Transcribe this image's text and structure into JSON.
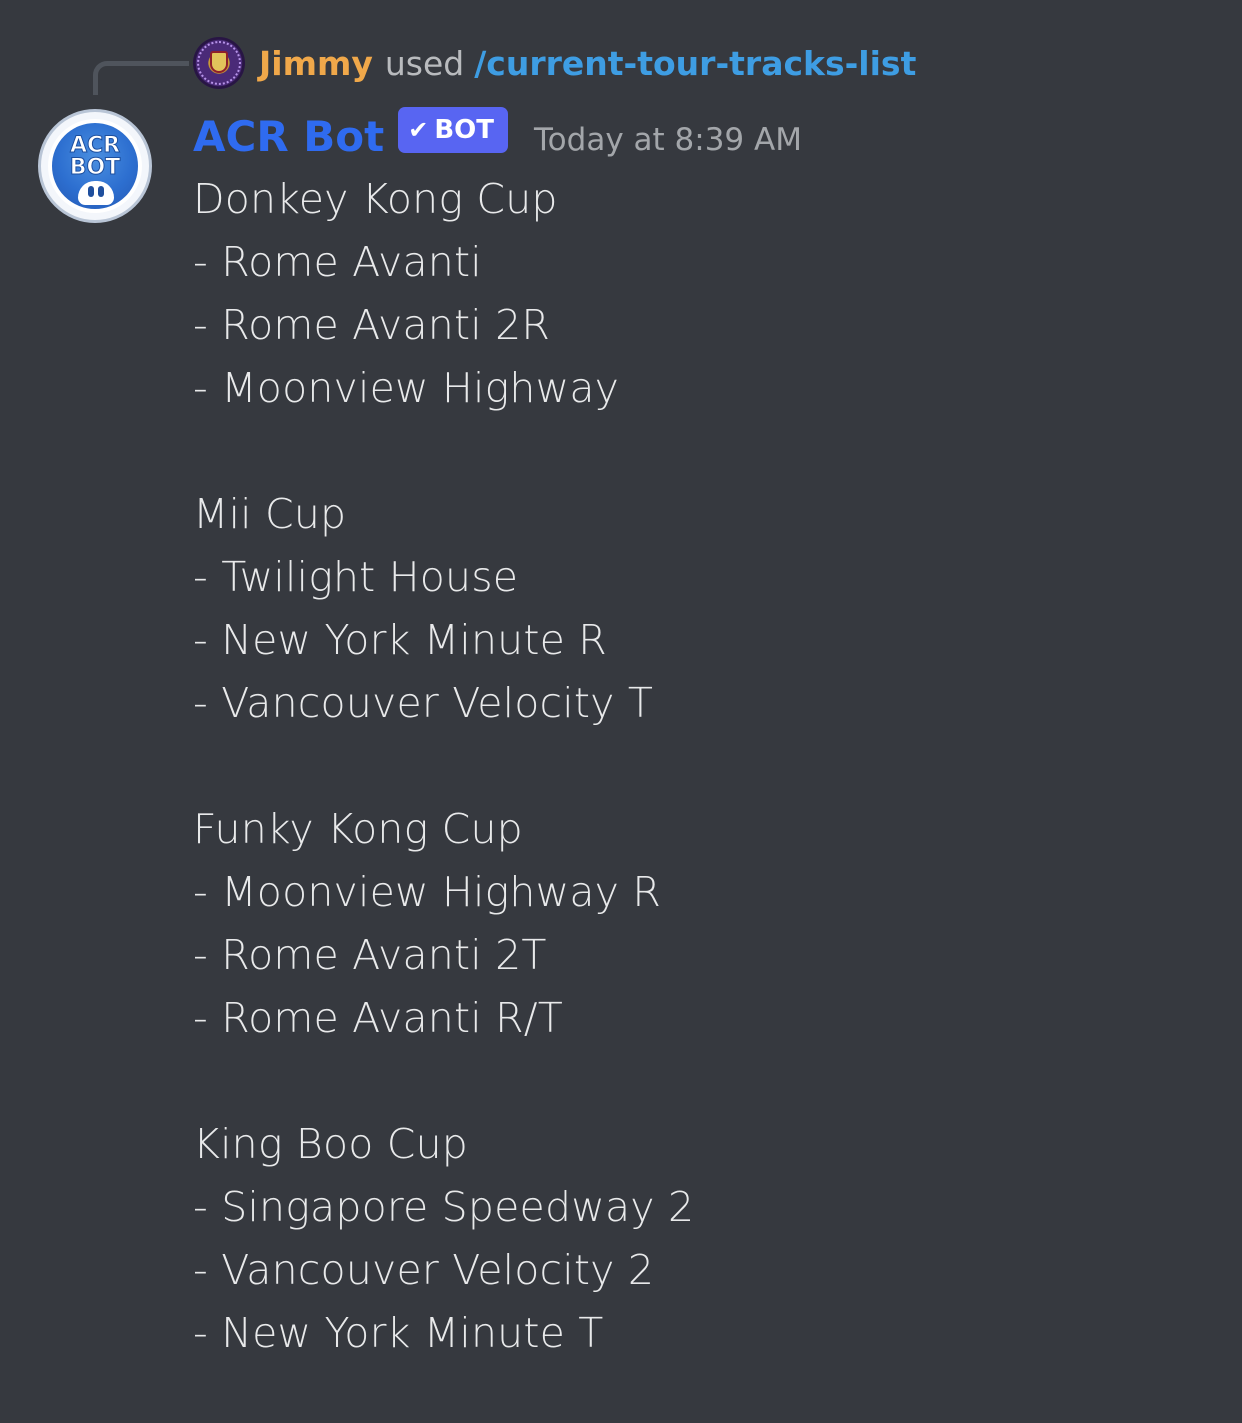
{
  "reply": {
    "user": "Jimmy",
    "used_text": "used",
    "command": "/current-tour-tracks-list"
  },
  "message": {
    "author": "ACR Bot",
    "badge": "BOT",
    "badge_icon": "check-icon",
    "timestamp": "Today at 8:39 AM",
    "avatar_text": [
      "ACR",
      "BOT"
    ],
    "content": "Donkey Kong Cup\n- Rome Avanti\n- Rome Avanti 2R\n- Moonview Highway\n\nMii Cup\n- Twilight House\n- New York Minute R\n- Vancouver Velocity T\n\nFunky Kong Cup\n- Moonview Highway R\n- Rome Avanti 2T\n- Rome Avanti R/T\n\nKing Boo Cup\n- Singapore Speedway 2\n- Vancouver Velocity 2\n- New York Minute T"
  },
  "colors": {
    "background": "#36393f",
    "reply_username": "#f0a84a",
    "command": "#3e9de3",
    "bot_name": "#2f6bf0",
    "bot_badge": "#5865f2",
    "text": "#dcddde",
    "muted": "#a3a6aa"
  }
}
